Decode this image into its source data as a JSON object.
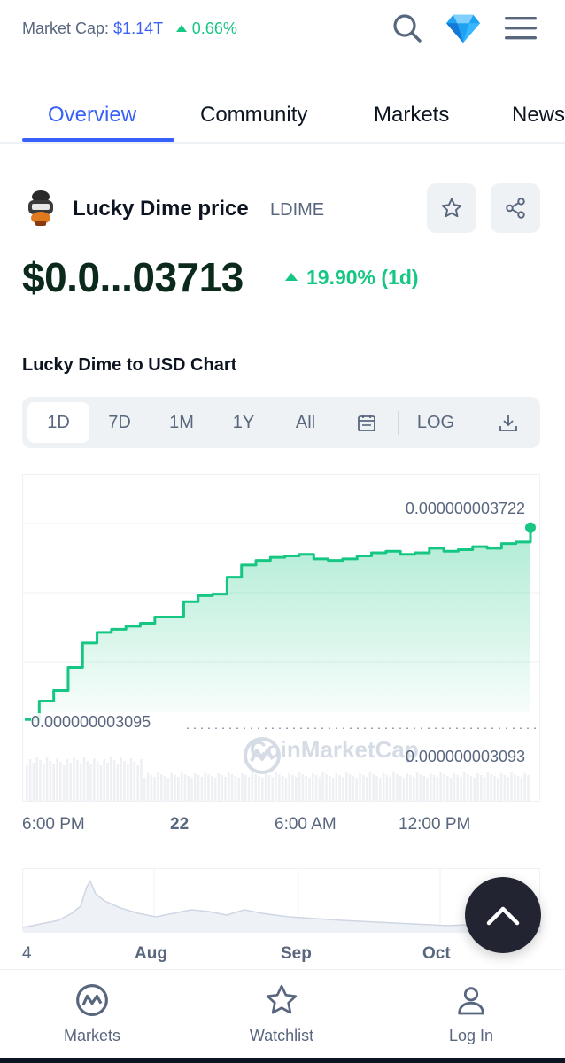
{
  "header": {
    "market_cap_label": "Market Cap:",
    "market_cap_value": "$1.14T",
    "market_cap_change": "0.66%",
    "icons": [
      "search-icon",
      "diamond-icon",
      "menu-icon"
    ]
  },
  "tabs": [
    {
      "label": "Overview",
      "active": true
    },
    {
      "label": "Community",
      "active": false
    },
    {
      "label": "Markets",
      "active": false
    },
    {
      "label": "News",
      "active": false
    }
  ],
  "coin": {
    "name": "Lucky Dime price",
    "symbol": "LDIME",
    "price": "$0.0...03713",
    "change": "19.90% (1d)",
    "up_color": "#16c784"
  },
  "chart": {
    "title": "Lucky Dime to USD Chart",
    "ranges": [
      "1D",
      "7D",
      "1M",
      "1Y",
      "All"
    ],
    "selected_range": "1D",
    "log_label": "LOG",
    "high_label": "0.000000003722",
    "open_label": "0.000000003095",
    "low_label": "0.000000003093",
    "watermark": "CoinMarketCap",
    "x_labels": [
      "6:00 PM",
      "22",
      "6:00 AM",
      "12:00 PM"
    ]
  },
  "chart_data": {
    "type": "area",
    "title": "Lucky Dime to USD Chart",
    "xlabel": "",
    "ylabel": "",
    "x_ticks": [
      "6:00 PM",
      "22",
      "6:00 AM",
      "12:00 PM"
    ],
    "ylim": [
      3.09e-09,
      3.75e-09
    ],
    "line_color": "#16c784",
    "grid": true,
    "series": [
      {
        "values": [
          3.095e-09,
          3.155e-09,
          3.19e-09,
          3.265e-09,
          3.345e-09,
          3.38e-09,
          3.39e-09,
          3.4e-09,
          3.41e-09,
          3.43e-09,
          3.43e-09,
          3.48e-09,
          3.5e-09,
          3.505e-09,
          3.56e-09,
          3.6e-09,
          3.615e-09,
          3.625e-09,
          3.63e-09,
          3.635e-09,
          3.62e-09,
          3.615e-09,
          3.62e-09,
          3.63e-09,
          3.64e-09,
          3.645e-09,
          3.635e-09,
          3.64e-09,
          3.655e-09,
          3.645e-09,
          3.65e-09,
          3.66e-09,
          3.655e-09,
          3.67e-09,
          3.675e-09,
          3.722e-09
        ]
      }
    ]
  },
  "overview": {
    "x_labels": [
      "4",
      "Aug",
      "Sep",
      "Oct"
    ]
  },
  "bottom_nav": [
    {
      "label": "Markets",
      "icon": "coinmarketcap-logo-icon"
    },
    {
      "label": "Watchlist",
      "icon": "star-icon"
    },
    {
      "label": "Log In",
      "icon": "user-icon"
    }
  ]
}
